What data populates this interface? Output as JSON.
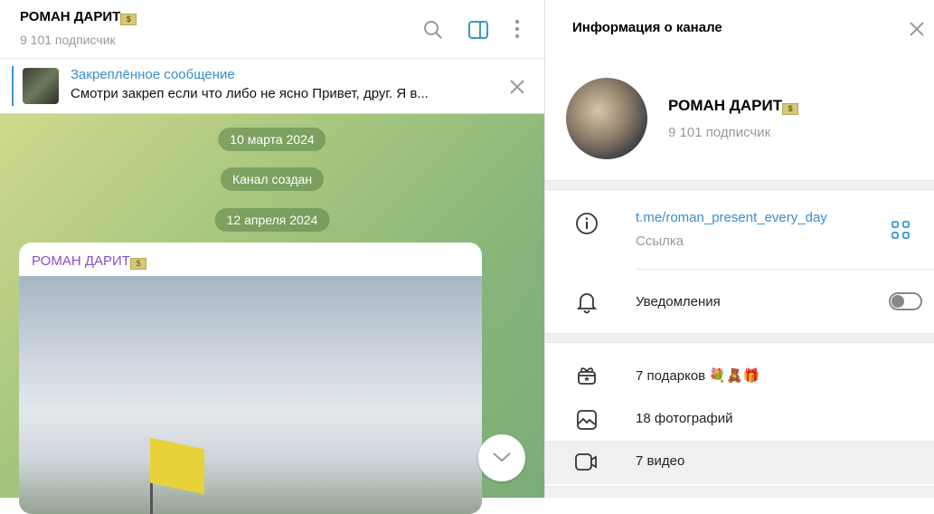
{
  "chat": {
    "title": "РОМАН ДАРИТ",
    "title_emoji": "💵",
    "subscribers": "9 101 подписчик",
    "pinned": {
      "title": "Закреплённое сообщение",
      "text": "Смотри закреп если что либо не ясно  Привет, друг. Я в..."
    },
    "service": [
      "10 марта 2024",
      "Канал создан",
      "12 апреля 2024"
    ],
    "message": {
      "author": "РОМАН ДАРИТ",
      "author_emoji": "💵"
    }
  },
  "info": {
    "header": "Информация о канале",
    "name": "РОМАН ДАРИТ",
    "name_emoji": "💵",
    "subscribers": "9 101 подписчик",
    "link": "t.me/roman_present_every_day",
    "link_label": "Ссылка",
    "notifications": "Уведомления",
    "notifications_on": false,
    "gifts": "7 подарков",
    "gift_emojis": "💐🧸🎁",
    "photos": "18 фотографий",
    "videos": "7 видео"
  }
}
